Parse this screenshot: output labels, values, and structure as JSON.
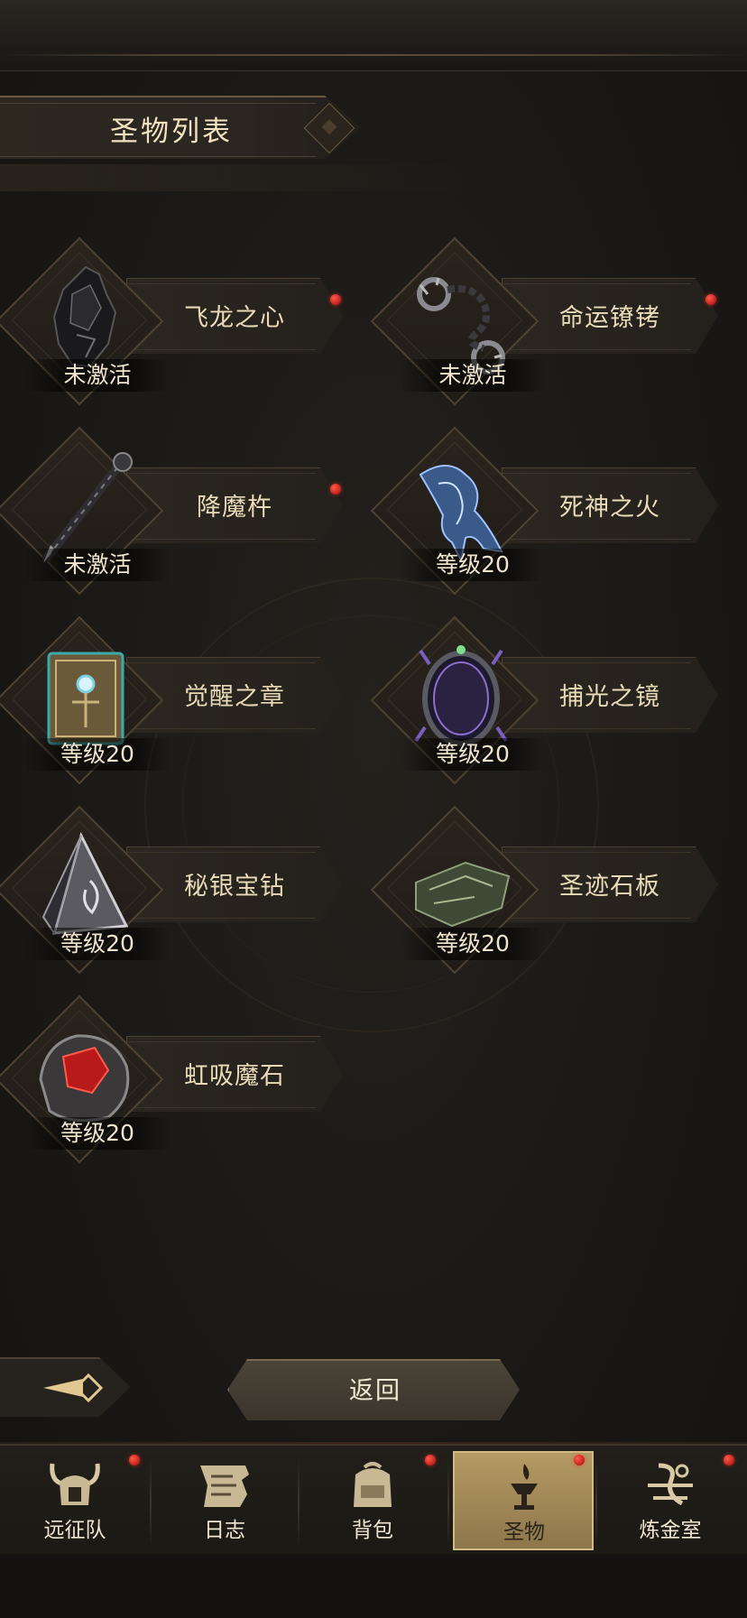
{
  "page": {
    "title": "圣物列表"
  },
  "relics": [
    {
      "name": "飞龙之心",
      "status": "未激活",
      "has_notification": true,
      "icon": "dragon-heart-icon"
    },
    {
      "name": "命运镣铐",
      "status": "未激活",
      "has_notification": true,
      "icon": "chain-shackles-icon"
    },
    {
      "name": "降魔杵",
      "status": "未激活",
      "has_notification": true,
      "icon": "demon-scepter-icon"
    },
    {
      "name": "死神之火",
      "status": "等级20",
      "has_notification": false,
      "icon": "blue-flame-hand-icon"
    },
    {
      "name": "觉醒之章",
      "status": "等级20",
      "has_notification": false,
      "icon": "awakening-tome-icon"
    },
    {
      "name": "捕光之镜",
      "status": "等级20",
      "has_notification": false,
      "icon": "light-mirror-icon"
    },
    {
      "name": "秘银宝钻",
      "status": "等级20",
      "has_notification": false,
      "icon": "mithril-pyramid-icon"
    },
    {
      "name": "圣迹石板",
      "status": "等级20",
      "has_notification": false,
      "icon": "stone-tablet-icon"
    },
    {
      "name": "虹吸魔石",
      "status": "等级20",
      "has_notification": false,
      "icon": "siphon-stone-icon"
    }
  ],
  "actions": {
    "back_label": "返回"
  },
  "bottom_nav": {
    "items": [
      {
        "label": "远征队",
        "icon": "horned-helmet-icon",
        "has_notification": true,
        "active": false
      },
      {
        "label": "日志",
        "icon": "scroll-icon",
        "has_notification": false,
        "active": false
      },
      {
        "label": "背包",
        "icon": "backpack-icon",
        "has_notification": true,
        "active": false
      },
      {
        "label": "圣物",
        "icon": "torch-chalice-icon",
        "has_notification": true,
        "active": true
      },
      {
        "label": "炼金室",
        "icon": "alchemy-icon",
        "has_notification": true,
        "active": false
      }
    ]
  },
  "colors": {
    "background": "#1b1916",
    "accent_gold": "#b49a63",
    "text": "#eadbb8",
    "notification_red": "#d02a20"
  }
}
